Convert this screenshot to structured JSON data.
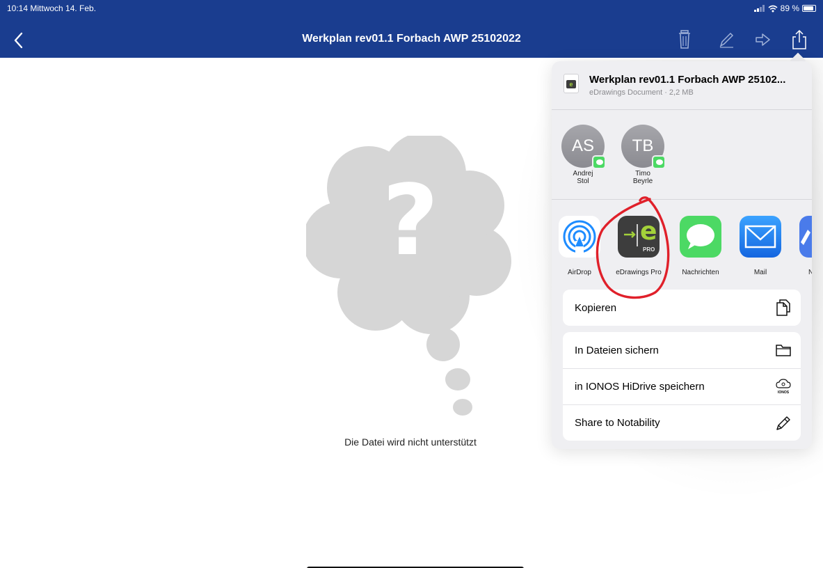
{
  "status_bar": {
    "time_date": "10:14  Mittwoch 14. Feb.",
    "battery": "89 %"
  },
  "header": {
    "title": "Werkplan rev01.1 Forbach AWP 25102022"
  },
  "main": {
    "message": "Die Datei wird nicht unterstützt"
  },
  "share_sheet": {
    "file": {
      "name": "Werkplan rev01.1 Forbach AWP 25102...",
      "meta": "eDrawings Document · 2,2 MB",
      "icon_letter": "e"
    },
    "people": [
      {
        "initials": "AS",
        "first": "Andrej",
        "last": "Stol"
      },
      {
        "initials": "TB",
        "first": "Timo",
        "last": "Beyrle"
      }
    ],
    "apps": [
      {
        "label": "AirDrop"
      },
      {
        "label": "eDrawings Pro",
        "badge": "PRO",
        "letter": "e"
      },
      {
        "label": "Nachrichten"
      },
      {
        "label": "Mail"
      },
      {
        "label": "No"
      }
    ],
    "actions_primary": [
      {
        "label": "Kopieren"
      }
    ],
    "actions_secondary": [
      {
        "label": "In Dateien sichern"
      },
      {
        "label": "in IONOS HiDrive speichern",
        "icon_caption": "IONOS"
      },
      {
        "label": "Share to Notability"
      }
    ]
  },
  "colors": {
    "header_blue": "#1a3d8f",
    "annotation_red": "#e0202a",
    "messages_green": "#4cd964",
    "mail_blue": "#1e8cff"
  }
}
